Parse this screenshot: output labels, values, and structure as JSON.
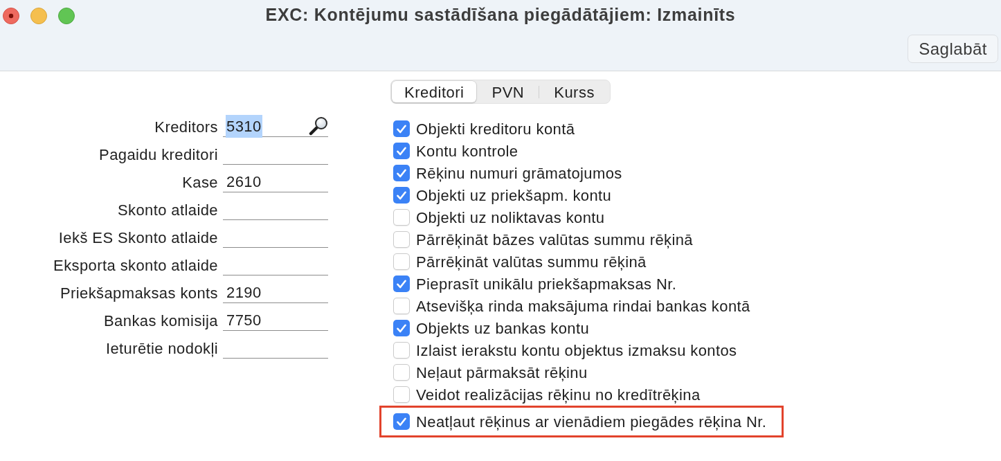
{
  "window": {
    "title": "EXC: Kontējumu sastādīšana piegādātājiem: Izmainīts"
  },
  "toolbar": {
    "buttons": [
      {
        "label": "Saglabāt"
      }
    ]
  },
  "tabs": [
    {
      "label": "Kreditori",
      "selected": true
    },
    {
      "label": "PVN",
      "selected": false
    },
    {
      "label": "Kurss",
      "selected": false
    }
  ],
  "fields": [
    {
      "label": "Kreditors",
      "value": "5310",
      "value_selected": true,
      "lookup": true
    },
    {
      "label": "Pagaidu kreditori",
      "value_selected": false,
      "lookup": false
    },
    {
      "label": "Kase",
      "value": "2610",
      "value_selected": false,
      "lookup": false
    },
    {
      "label": "Skonto atlaide",
      "value_selected": false,
      "lookup": false
    },
    {
      "label": "Iekš ES Skonto atlaide",
      "value_selected": false,
      "lookup": false
    },
    {
      "label": "Eksporta skonto atlaide",
      "value_selected": false,
      "lookup": false
    },
    {
      "label": "Priekšapmaksas konts",
      "value": "2190",
      "value_selected": false,
      "lookup": false
    },
    {
      "label": "Bankas komisija",
      "value": "7750",
      "value_selected": false,
      "lookup": false
    },
    {
      "label": "Ieturētie nodokļi",
      "value_selected": false,
      "lookup": false
    }
  ],
  "options": [
    {
      "label": "Objekti kreditoru kontā",
      "checked": true,
      "highlighted": false
    },
    {
      "label": "Kontu kontrole",
      "checked": true,
      "highlighted": false
    },
    {
      "label": "Rēķinu numuri grāmatojumos",
      "checked": true,
      "highlighted": false
    },
    {
      "label": "Objekti uz priekšapm. kontu",
      "checked": true,
      "highlighted": false
    },
    {
      "label": "Objekti uz noliktavas kontu",
      "checked": false,
      "highlighted": false
    },
    {
      "label": "Pārrēķināt bāzes valūtas summu rēķinā",
      "checked": false,
      "highlighted": false
    },
    {
      "label": "Pārrēķināt valūtas summu rēķinā",
      "checked": false,
      "highlighted": false
    },
    {
      "label": "Pieprasīt unikālu priekšapmaksas Nr.",
      "checked": true,
      "highlighted": false
    },
    {
      "label": "Atsevišķa rinda maksājuma rindai bankas kontā",
      "checked": false,
      "highlighted": false
    },
    {
      "label": "Objekts uz bankas kontu",
      "checked": true,
      "highlighted": false
    },
    {
      "label": "Izlaist ierakstu kontu objektus izmaksu kontos",
      "checked": false,
      "highlighted": false
    },
    {
      "label": "Neļaut pārmaksāt rēķinu",
      "checked": false,
      "highlighted": false
    },
    {
      "label": "Veidot realizācijas rēķinu no kredītrēķina",
      "checked": false,
      "highlighted": false
    },
    {
      "label": "Neatļaut rēķinus ar vienādiem piegādes rēķina Nr.",
      "checked": true,
      "highlighted": true
    }
  ]
}
